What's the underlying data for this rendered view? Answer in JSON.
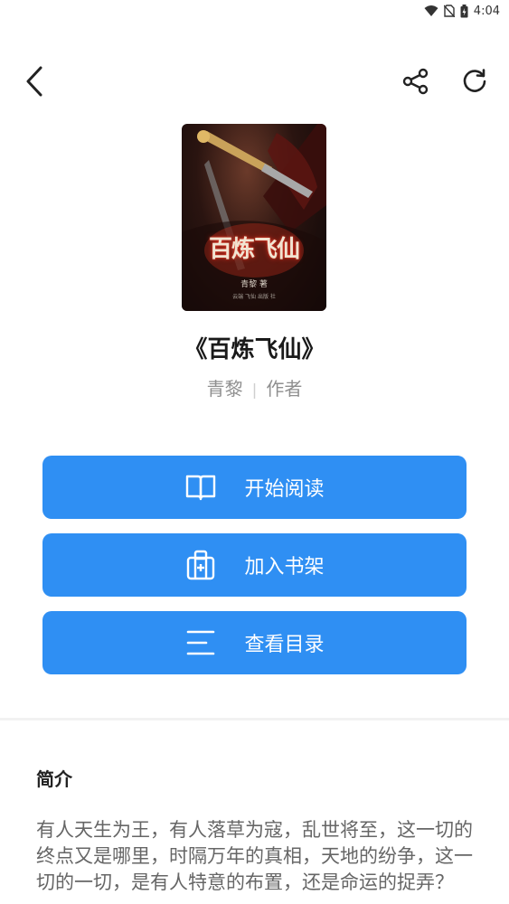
{
  "status_bar": {
    "time": "4:04"
  },
  "book": {
    "title": "《百炼飞仙》",
    "author": "青黎",
    "role": "作者",
    "cover": {
      "title": "百炼飞仙",
      "author": "青黎 著",
      "publisher": "云端 飞仙 出版 社"
    }
  },
  "actions": {
    "read_label": "开始阅读",
    "shelf_label": "加入书架",
    "toc_label": "查看目录"
  },
  "intro": {
    "heading": "简介",
    "text": "有人天生为王，有人落草为寇，乱世将至，这一切的终点又是哪里，时隔万年的真相，天地的纷争，这一切的一切，是有人特意的布置，还是命运的捉弄？"
  },
  "colors": {
    "accent": "#2f8ff3",
    "muted": "#8f8f8f"
  },
  "icons": [
    "wifi-icon",
    "no-sim-icon",
    "battery-icon",
    "back-arrow-icon",
    "share-icon",
    "refresh-icon",
    "book-open-icon",
    "bookshelf-add-icon",
    "list-icon"
  ]
}
